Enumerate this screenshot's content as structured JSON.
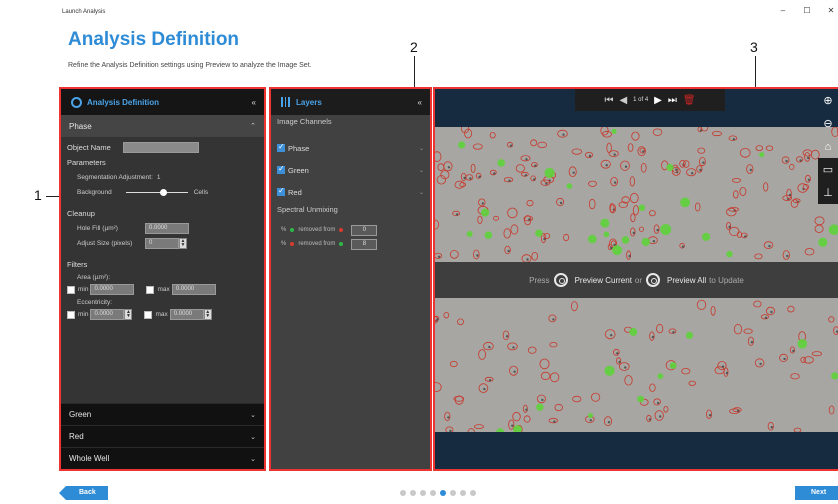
{
  "window": {
    "title": "Launch Analysis",
    "controls": [
      "–",
      "☐",
      "✕"
    ]
  },
  "header": {
    "title": "Analysis Definition",
    "subtitle": "Refine the Analysis Definition settings using Preview to analyze the Image Set."
  },
  "callouts": [
    "1",
    "2",
    "3"
  ],
  "panel1": {
    "title": "Analysis Definition",
    "collapse_glyph": "«",
    "phase": {
      "label": "Phase",
      "chevron": "⌃",
      "object_name_label": "Object Name",
      "object_name_value": "",
      "parameters_label": "Parameters",
      "segmentation_label": "Segmentation Adjustment:",
      "segmentation_value": "1",
      "background_label": "Background",
      "cells_label": "Cells",
      "slider_position": 0.62,
      "cleanup_label": "Cleanup",
      "hole_fill_label": "Hole Fill (µm²)",
      "hole_fill_value": "0.0000",
      "adjust_size_label": "Adjust Size (pixels)",
      "adjust_size_value": "0",
      "filters_label": "Filters",
      "area_label": "Area (µm²):",
      "min_label": "min",
      "max_label": "max",
      "area_min": "0.0000",
      "area_max": "0.0000",
      "eccentricity_label": "Eccentricity:",
      "ecc_min": "0.0000",
      "ecc_max": "0.0000"
    },
    "bottom_sections": [
      {
        "label": "Green",
        "chevron": "⌄"
      },
      {
        "label": "Red",
        "chevron": "⌄"
      },
      {
        "label": "Whole Well",
        "chevron": "⌄"
      }
    ]
  },
  "panel2": {
    "title": "Layers",
    "collapse_glyph": "«",
    "image_channels_label": "Image Channels",
    "channels": [
      {
        "label": "Phase",
        "chevron": "⌄"
      },
      {
        "label": "Green",
        "chevron": "⌄"
      },
      {
        "label": "Red",
        "chevron": "⌄"
      }
    ],
    "spectral_label": "Spectral Unmixing",
    "unmix": [
      {
        "pct": "%",
        "text": "removed from",
        "value": "0",
        "c1": "#2fb84a",
        "c2": "#d83b2f"
      },
      {
        "pct": "%",
        "text": "removed from",
        "value": "8",
        "c1": "#d83b2f",
        "c2": "#2fb84a"
      }
    ]
  },
  "viewer": {
    "page_indicator": "1 of 4",
    "press_text": "Press",
    "preview_current": "Preview Current",
    "or_text": "or",
    "preview_all": "Preview All",
    "to_update": "to Update",
    "tool_icons": [
      "zoom-in-icon",
      "zoom-out-icon",
      "home-icon",
      "ruler-icon",
      "scale-bar-icon"
    ]
  },
  "footer": {
    "back_label": "Back",
    "next_label": "Next",
    "step_count": 8,
    "active_step": 5
  }
}
